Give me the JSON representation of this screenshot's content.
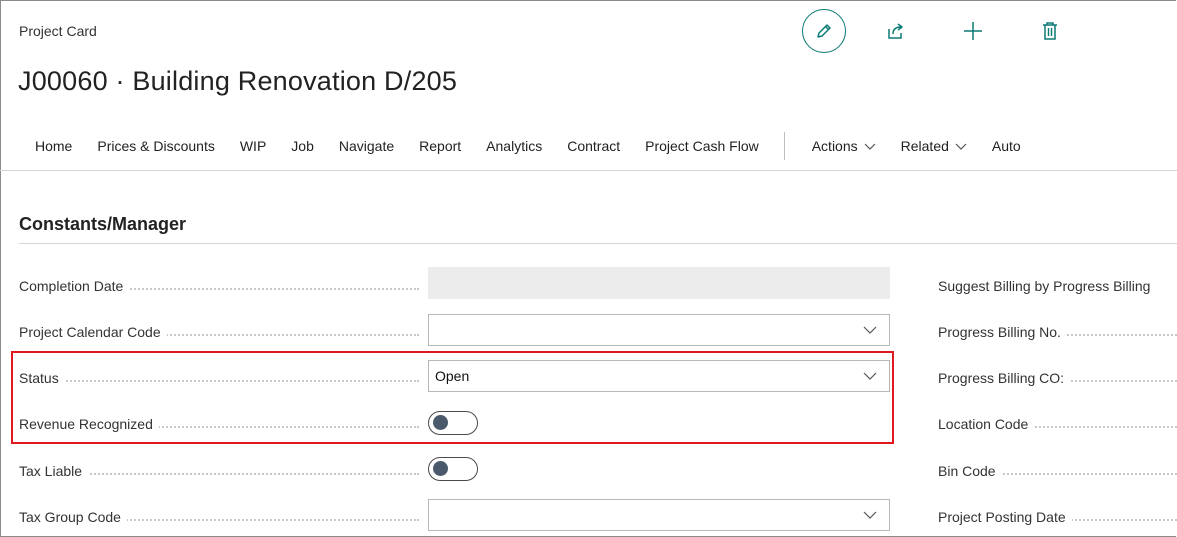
{
  "header": {
    "caption": "Project Card",
    "title": "J00060 · Building Renovation D/205"
  },
  "actions": [
    {
      "icon": "pencil-icon"
    },
    {
      "icon": "share-icon"
    },
    {
      "icon": "plus-icon"
    },
    {
      "icon": "trash-icon"
    }
  ],
  "nav": {
    "items": [
      "Home",
      "Prices & Discounts",
      "WIP",
      "Job",
      "Navigate",
      "Report",
      "Analytics",
      "Contract",
      "Project Cash Flow"
    ],
    "menus": [
      "Actions",
      "Related",
      "Auto"
    ]
  },
  "section": {
    "title": "Constants/Manager"
  },
  "fields": {
    "completion_date": {
      "label": "Completion Date",
      "value": ""
    },
    "calendar_code": {
      "label": "Project Calendar Code",
      "value": ""
    },
    "status": {
      "label": "Status",
      "value": "Open"
    },
    "revenue_recognized": {
      "label": "Revenue Recognized",
      "on": false
    },
    "tax_liable": {
      "label": "Tax Liable",
      "on": false
    },
    "tax_group_code": {
      "label": "Tax Group Code",
      "value": ""
    }
  },
  "right_fields": [
    "Suggest Billing by Progress Billing",
    "Progress Billing No.",
    "Progress Billing CO:",
    "Location Code",
    "Bin Code",
    "Project Posting Date"
  ],
  "colors": {
    "accent": "#0b7a75",
    "highlight": "#e0191f"
  }
}
